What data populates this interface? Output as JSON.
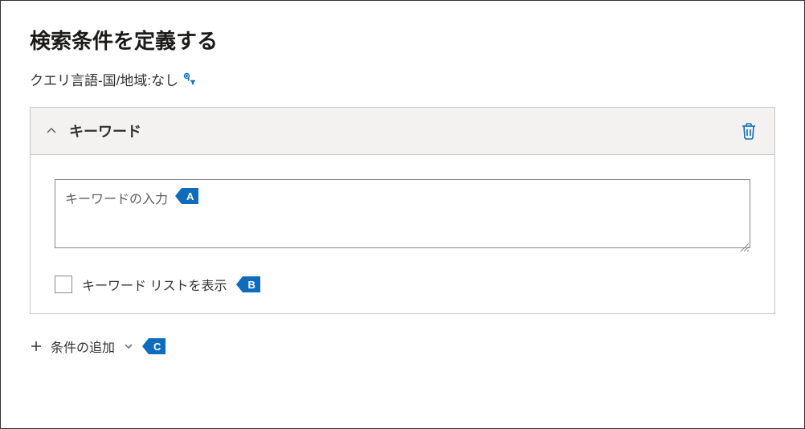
{
  "page": {
    "title": "検索条件を定義する",
    "query_language_label": "クエリ言語-国/地域:なし"
  },
  "keyword_panel": {
    "title": "キーワード",
    "placeholder": "キーワードの入力",
    "value": "",
    "show_list_label": "キーワード リストを表示",
    "show_list_checked": false
  },
  "add_condition": {
    "label": "条件の追加"
  },
  "callouts": {
    "a": "A",
    "b": "B",
    "c": "C"
  },
  "icons": {
    "translate": "translate-icon",
    "chevron_up": "chevron-up-icon",
    "trash": "trash-icon",
    "plus": "plus-icon",
    "chevron_down": "chevron-down-icon"
  },
  "colors": {
    "accent": "#0f6cbd",
    "panel_bg": "#f3f2f1",
    "border": "#c8c6c4",
    "text": "#323130"
  }
}
